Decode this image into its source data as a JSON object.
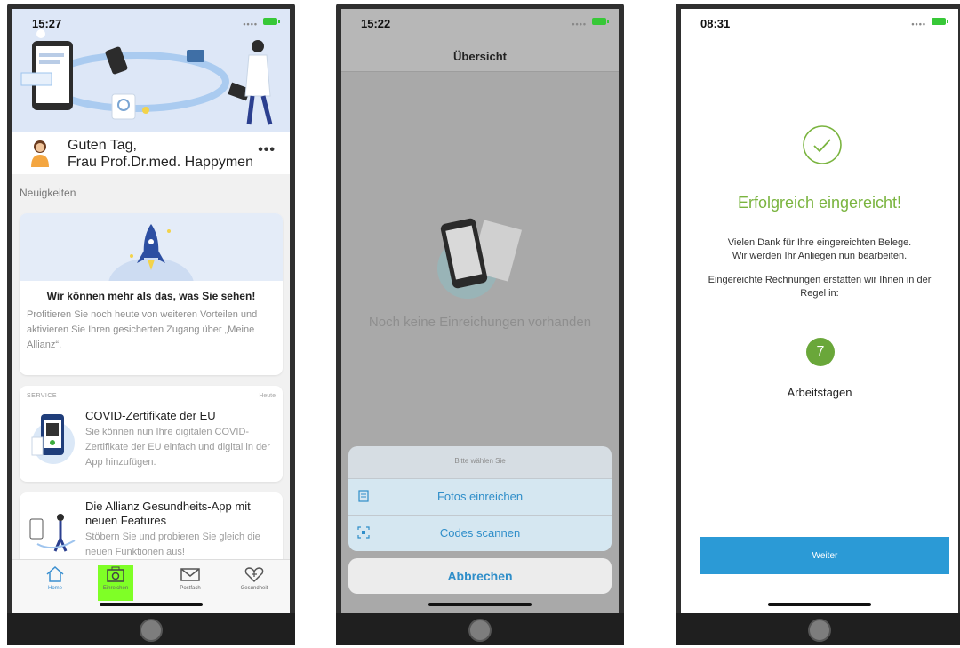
{
  "phone1": {
    "status": {
      "time": "15:27"
    },
    "greeting": {
      "line1": "Guten Tag,",
      "line2": "Frau Prof.Dr.med. Happymen",
      "more": "•••"
    },
    "feed": {
      "section_label": "Neuigkeiten",
      "card1": {
        "title": "Wir können mehr als das, was Sie sehen!",
        "body": "Profitieren Sie noch heute von weiteren Vorteilen und aktivieren Sie Ihren gesicherten Zugang über „Meine Allianz“."
      },
      "card2": {
        "tag": "SERVICE",
        "date": "Heute",
        "title": "COVID-Zertifikate der EU",
        "body": "Sie können nun Ihre digitalen COVID-Zertifikate der EU einfach und digital in der App hinzufügen."
      },
      "card3": {
        "title": "Die Allianz Gesundheits-App mit neuen Features",
        "body": "Stöbern Sie und probieren Sie gleich die neuen Funktionen aus!"
      }
    },
    "tabs": [
      {
        "label": "Home",
        "icon": "house-icon"
      },
      {
        "label": "Einreichen",
        "icon": "camera-icon"
      },
      {
        "label": "Postfach",
        "icon": "envelope-icon"
      },
      {
        "label": "Gesundheit",
        "icon": "heart-icon"
      }
    ],
    "colors": {
      "active_tab": "#7fff26",
      "accent": "#3a8fd0"
    }
  },
  "phone2": {
    "status": {
      "time": "15:22"
    },
    "nav_title": "Übersicht",
    "empty_text": "Noch keine Einreichungen vorhanden",
    "sheet": {
      "title": "Bitte wählen Sie",
      "options": [
        {
          "label": "Fotos einreichen",
          "icon": "document-icon"
        },
        {
          "label": "Codes scannen",
          "icon": "scan-icon"
        }
      ],
      "cancel": "Abbrechen"
    }
  },
  "phone3": {
    "status": {
      "time": "08:31"
    },
    "title": "Erfolgreich eingereicht!",
    "body1_line1": "Vielen Dank für Ihre eingereichten Belege.",
    "body1_line2": "Wir werden Ihr Anliegen nun bearbeiten.",
    "body2_line1": "Eingereichte Rechnungen erstatten wir Ihnen in der",
    "body2_line2": "Regel in:",
    "days": "7",
    "days_label": "Arbeitstagen",
    "button": "Weiter",
    "colors": {
      "success": "#7ab43f",
      "button": "#2b9ad6"
    }
  }
}
